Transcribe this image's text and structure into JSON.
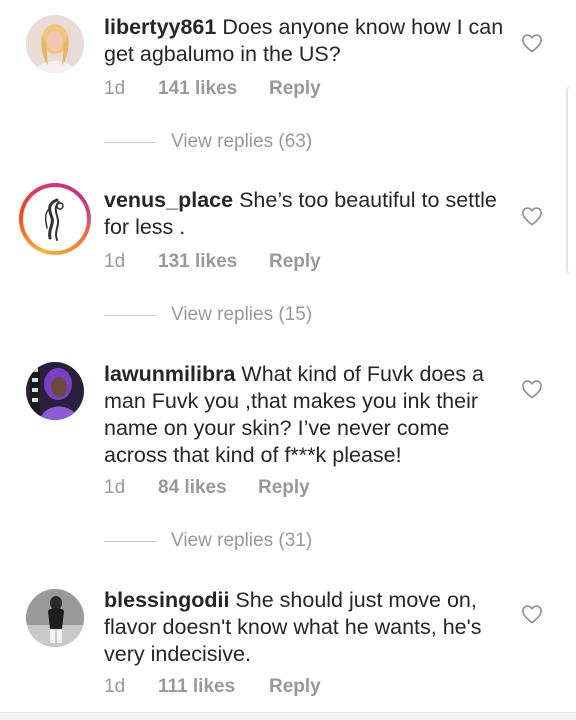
{
  "comments": [
    {
      "username": "libertyy861",
      "text": "Does anyone know how I can get agbalumo in the US?",
      "time": "1d",
      "likes": "141 likes",
      "reply": "Reply",
      "view_replies": "View replies (63)",
      "avatar_icon": "user-photo-avatar"
    },
    {
      "username": "venus_place",
      "text": "She’s too beautiful to settle for less .",
      "time": "1d",
      "likes": "131 likes",
      "reply": "Reply",
      "view_replies": "View replies (15)",
      "avatar_icon": "hair-logo-avatar-with-story-ring"
    },
    {
      "username": "lawunmilibra",
      "text": "What kind of Fuvk does a man Fuvk you ,that makes you ink their name on your skin? I’ve never come across that kind of f***k please!",
      "time": "1d",
      "likes": "84 likes",
      "reply": "Reply",
      "view_replies": "View replies (31)",
      "avatar_icon": "purple-photo-avatar"
    },
    {
      "username": "blessingodii",
      "text": "She should just move on, flavor doesn't know what he wants, he's very indecisive.",
      "time": "1d",
      "likes": "111 likes",
      "reply": "Reply",
      "avatar_icon": "grayscale-photo-avatar"
    }
  ],
  "colors": {
    "text": "#262626",
    "secondary": "#999999",
    "divider": "#c7c7c7",
    "story_ring": "#e1306c"
  }
}
